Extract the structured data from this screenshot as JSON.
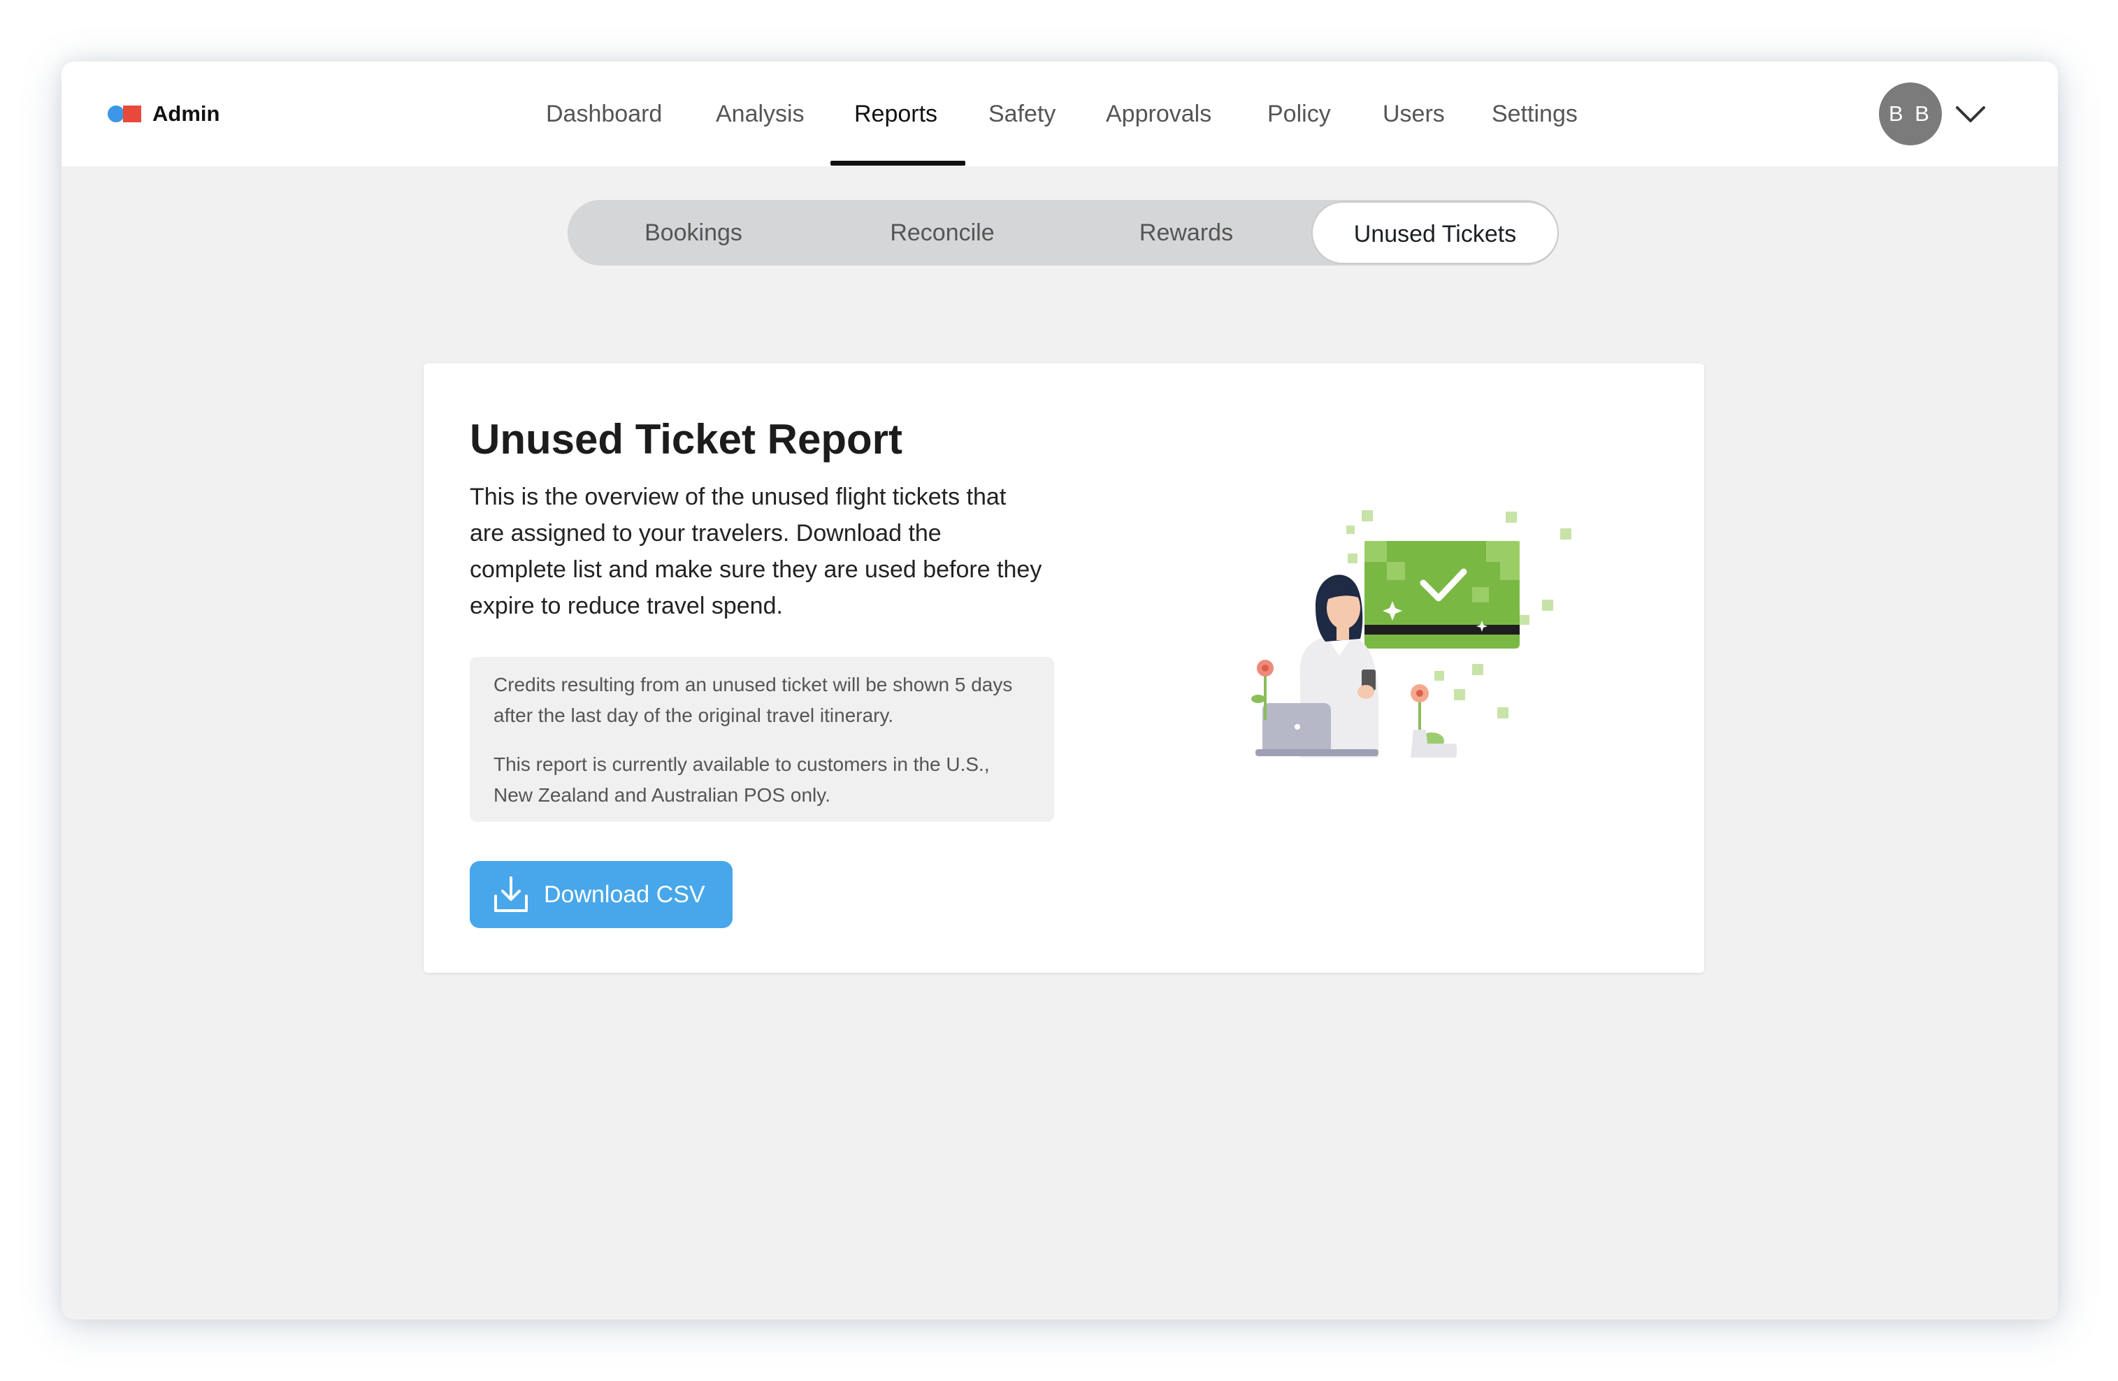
{
  "app": {
    "brand": "Admin",
    "brand_colors": {
      "dot": "#3c97e8",
      "square": "#e9493a"
    }
  },
  "nav": {
    "items": [
      {
        "label": "Dashboard",
        "active": false
      },
      {
        "label": "Analysis",
        "active": false
      },
      {
        "label": "Reports",
        "active": true
      },
      {
        "label": "Safety",
        "active": false
      },
      {
        "label": "Approvals",
        "active": false
      },
      {
        "label": "Policy",
        "active": false
      },
      {
        "label": "Users",
        "active": false
      },
      {
        "label": "Settings",
        "active": false
      }
    ]
  },
  "user": {
    "initials": "B B",
    "menu_icon": "chevron-down-icon"
  },
  "subtabs": {
    "items": [
      {
        "label": "Bookings",
        "active": false
      },
      {
        "label": "Reconcile",
        "active": false
      },
      {
        "label": "Rewards",
        "active": false
      },
      {
        "label": "Unused Tickets",
        "active": true
      }
    ]
  },
  "report": {
    "title": "Unused Ticket Report",
    "description": "This is the overview of the unused flight tickets that are assigned to your travelers. Download the complete list and make sure they are used before they expire to reduce travel spend.",
    "notes": [
      "Credits resulting from an unused ticket will be shown 5 days after the last day of the original travel itinerary.",
      "This report is currently available to customers in the U.S., New Zealand and Australian POS only."
    ],
    "download_label": "Download CSV",
    "download_icon": "download-icon",
    "illustration": "traveler-ticket-illustration"
  },
  "colors": {
    "accent": "#47a7ea",
    "ticket_green": "#7ab844",
    "page_bg": "#f1f1f2"
  }
}
